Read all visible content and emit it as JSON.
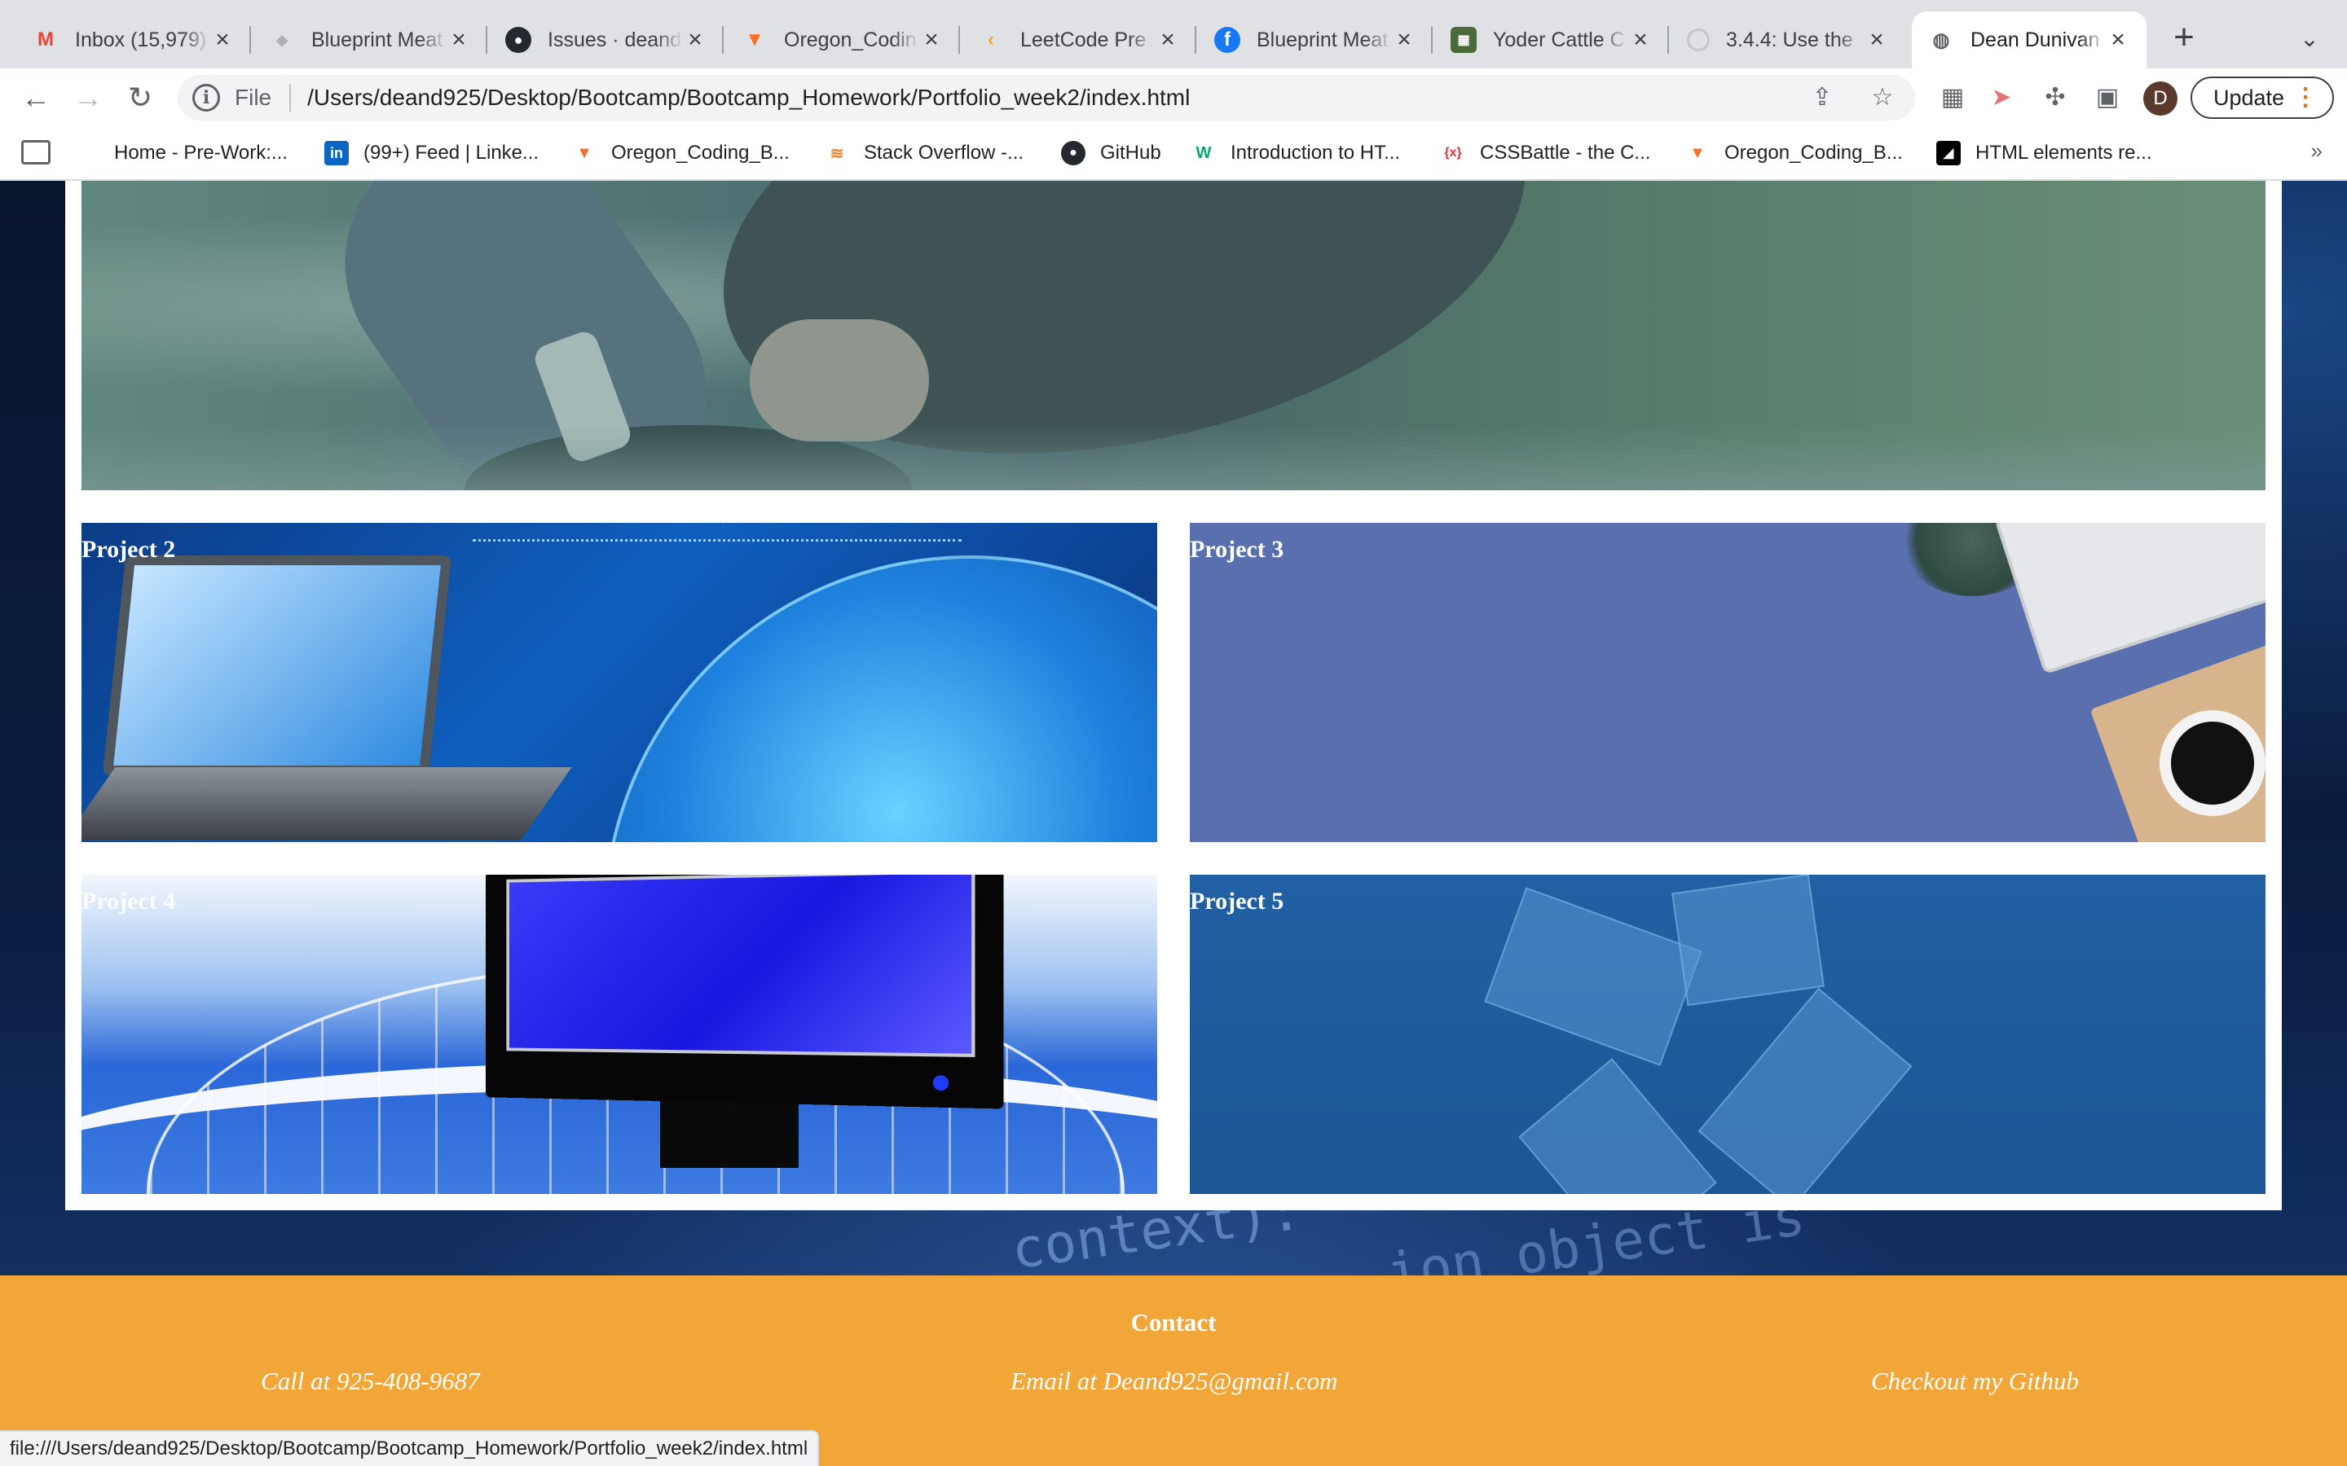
{
  "tabs": [
    {
      "title": "Inbox (15,979)",
      "icon": "gmail-icon",
      "active": false
    },
    {
      "title": "Blueprint Meat",
      "icon": "blueprint-icon",
      "active": false
    },
    {
      "title": "Issues · deand",
      "icon": "github-icon",
      "active": false
    },
    {
      "title": "Oregon_Codin",
      "icon": "gitlab-icon",
      "active": false
    },
    {
      "title": "LeetCode Pre",
      "icon": "leetcode-icon",
      "active": false
    },
    {
      "title": "Blueprint Meat",
      "icon": "facebook-icon",
      "active": false
    },
    {
      "title": "Yoder Cattle C",
      "icon": "cattle-icon",
      "active": false
    },
    {
      "title": "3.4.4: Use the",
      "icon": "generic-circle-icon",
      "active": false
    },
    {
      "title": "Dean Dunivan",
      "icon": "globe-icon",
      "active": true
    }
  ],
  "toolbar": {
    "scheme_label": "File",
    "url": "/Users/deand925/Desktop/Bootcamp/Bootcamp_Homework/Portfolio_week2/index.html",
    "profile_initial": "D",
    "update_label": "Update"
  },
  "bookmarks": [
    {
      "label": "Home - Pre-Work:...",
      "icon": "canvas-icon"
    },
    {
      "label": "(99+) Feed | Linke...",
      "icon": "linkedin-icon"
    },
    {
      "label": "Oregon_Coding_B...",
      "icon": "gitlab-icon"
    },
    {
      "label": "Stack Overflow -...",
      "icon": "stackoverflow-icon"
    },
    {
      "label": "GitHub",
      "icon": "github-icon"
    },
    {
      "label": "Introduction to HT...",
      "icon": "w3schools-icon"
    },
    {
      "label": "CSSBattle - the C...",
      "icon": "cssbattle-icon"
    },
    {
      "label": "Oregon_Coding_B...",
      "icon": "gitlab-icon"
    },
    {
      "label": "HTML elements re...",
      "icon": "mdn-icon"
    }
  ],
  "projects": [
    {
      "title": "Project 2"
    },
    {
      "title": "Project 3"
    },
    {
      "title": "Project 4"
    },
    {
      "title": "Project 5"
    }
  ],
  "background_code_text": [
    "context):",
    "ion object is"
  ],
  "footer": {
    "heading": "Contact",
    "phone": "Call at 925-408-9687",
    "email": "Email at Deand925@gmail.com",
    "github": "Checkout my Github"
  },
  "status_url": "file:///Users/deand925/Desktop/Bootcamp/Bootcamp_Homework/Portfolio_week2/index.html",
  "colors": {
    "footer_bg": "#f1a637",
    "tabstrip_bg": "#dfe1e5",
    "update_accent": "#e8710a"
  }
}
